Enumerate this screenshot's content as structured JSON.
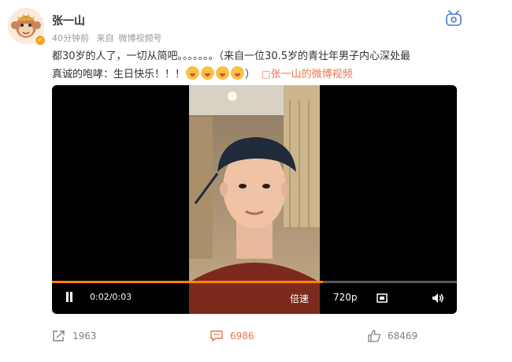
{
  "post": {
    "author": "张一山",
    "time_ago": "40分钟前",
    "source_prefix": "来自",
    "source": "微博视频号",
    "text_line1": "都30岁的人了，一切从简吧。。。。。。。（来自一位30.5岁的青壮年男子内心深处最",
    "text_line2": "真诚的咆哮：生日快乐！！！",
    "text_close": "）",
    "video_link_icon": "□",
    "video_link": "张一山的微博视频"
  },
  "player": {
    "time": "0:02/0:03",
    "progress": 0.67,
    "speed_label": "倍速",
    "quality_label": "720p",
    "icons": [
      "pause-icon",
      "fullscreen-icon",
      "volume-icon"
    ]
  },
  "footer": {
    "reposts": "1963",
    "comments": "6986",
    "likes": "68469"
  },
  "colors": {
    "accent": "#eb7350",
    "progress": "#ff8200",
    "verified": "#f5a623"
  }
}
